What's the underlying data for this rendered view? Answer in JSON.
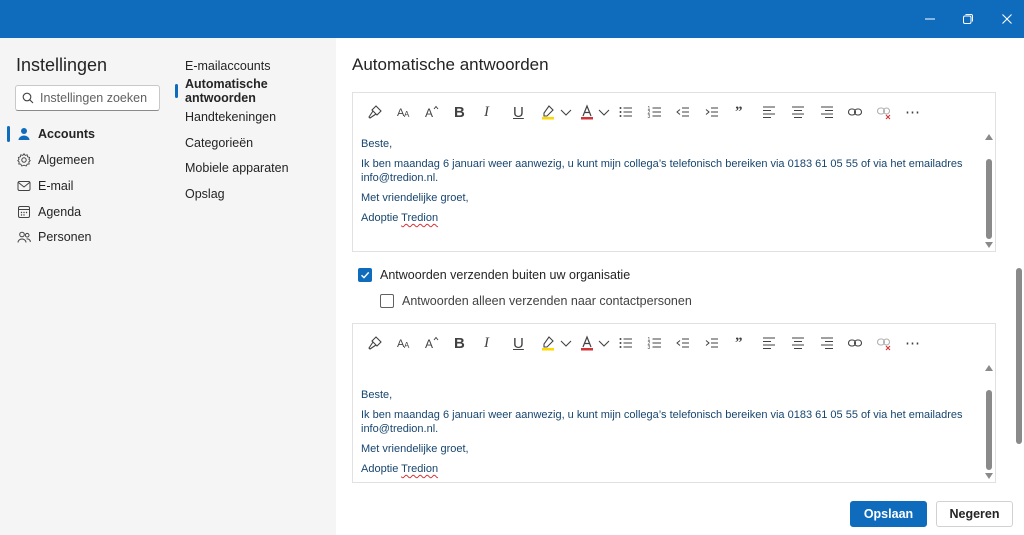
{
  "window": {
    "controls": {
      "minimize": "minimize-icon",
      "restore": "restore-icon",
      "close": "close-icon"
    },
    "accent_color": "#0f6cbd"
  },
  "settings": {
    "title": "Instellingen",
    "search": {
      "placeholder": "Instellingen zoeken",
      "value": ""
    },
    "nav": [
      {
        "label": "Accounts",
        "icon": "person-icon",
        "active": true
      },
      {
        "label": "Algemeen",
        "icon": "gear-icon",
        "active": false
      },
      {
        "label": "E-mail",
        "icon": "mail-icon",
        "active": false
      },
      {
        "label": "Agenda",
        "icon": "calendar-icon",
        "active": false
      },
      {
        "label": "Personen",
        "icon": "people-icon",
        "active": false
      }
    ]
  },
  "subnav": [
    {
      "label": "E-mailaccounts",
      "active": false
    },
    {
      "label": "Automatische antwoorden",
      "active": true
    },
    {
      "label": "Handtekeningen",
      "active": false
    },
    {
      "label": "Categorieën",
      "active": false
    },
    {
      "label": "Mobiele apparaten",
      "active": false
    },
    {
      "label": "Opslag",
      "active": false
    }
  ],
  "main": {
    "title": "Automatische antwoorden",
    "toolbar_items": [
      "format-painter-icon",
      "font-size-icon",
      "increase-font-icon",
      "bold-icon",
      "italic-icon",
      "underline-icon",
      "highlight-icon",
      "font-color-icon",
      "bullets-icon",
      "numbering-icon",
      "decrease-indent-icon",
      "increase-indent-icon",
      "quote-icon",
      "align-left-icon",
      "align-center-icon",
      "align-right-icon",
      "link-icon",
      "remove-link-icon",
      "more-icon"
    ],
    "toolbar_glyphs": {
      "bold": "B",
      "italic": "I",
      "underline": "U",
      "font_size": "A",
      "quote": "”",
      "more": "⋯"
    },
    "inside_message": {
      "greeting": "Beste,",
      "body": "Ik ben maandag 6 januari weer aanwezig, u kunt mijn collega’s telefonisch bereiken via 0183 61 05 55 of via het emailadres info@tredion.nl.",
      "closing": "Met vriendelijke groet,",
      "signature_prefix": "Adoptie ",
      "signature_name": "Tredion"
    },
    "outside_checkbox": {
      "label": "Antwoorden verzenden buiten uw organisatie",
      "checked": true
    },
    "contacts_checkbox": {
      "label": "Antwoorden alleen verzenden naar contactpersonen",
      "checked": false
    },
    "outside_message": {
      "greeting": "Beste,",
      "body": "Ik ben maandag 6 januari weer aanwezig, u kunt mijn collega’s telefonisch bereiken via 0183 61 05 55 of via het emailadres info@tredion.nl.",
      "closing": "Met vriendelijke groet,",
      "signature_prefix": "Adoptie ",
      "signature_name": "Tredion"
    }
  },
  "footer": {
    "save_label": "Opslaan",
    "discard_label": "Negeren"
  }
}
